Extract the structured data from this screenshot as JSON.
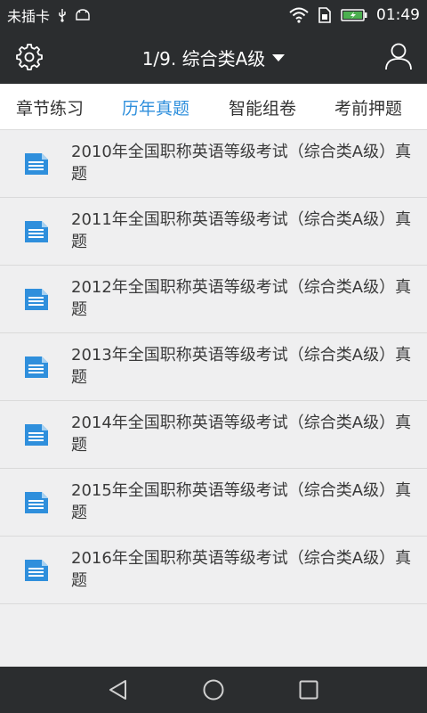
{
  "status": {
    "carrier": "未插卡",
    "time": "01:49"
  },
  "header": {
    "title": "1/9. 综合类A级"
  },
  "tabs": [
    {
      "label": "章节练习"
    },
    {
      "label": "历年真题"
    },
    {
      "label": "智能组卷"
    },
    {
      "label": "考前押题"
    }
  ],
  "papers": [
    {
      "title": "2010年全国职称英语等级考试（综合类A级）真题"
    },
    {
      "title": "2011年全国职称英语等级考试（综合类A级）真题"
    },
    {
      "title": "2012年全国职称英语等级考试（综合类A级）真题"
    },
    {
      "title": "2013年全国职称英语等级考试（综合类A级）真题"
    },
    {
      "title": "2014年全国职称英语等级考试（综合类A级）真题"
    },
    {
      "title": "2015年全国职称英语等级考试（综合类A级）真题"
    },
    {
      "title": "2016年全国职称英语等级考试（综合类A级）真题"
    }
  ],
  "colors": {
    "accent": "#2f8fdc",
    "bar": "#2b2d2f",
    "background": "#efeff0"
  },
  "icons": {
    "settings": "gear-icon",
    "user": "user-icon",
    "paper": "document-icon",
    "dropdown": "caret-down-icon"
  }
}
